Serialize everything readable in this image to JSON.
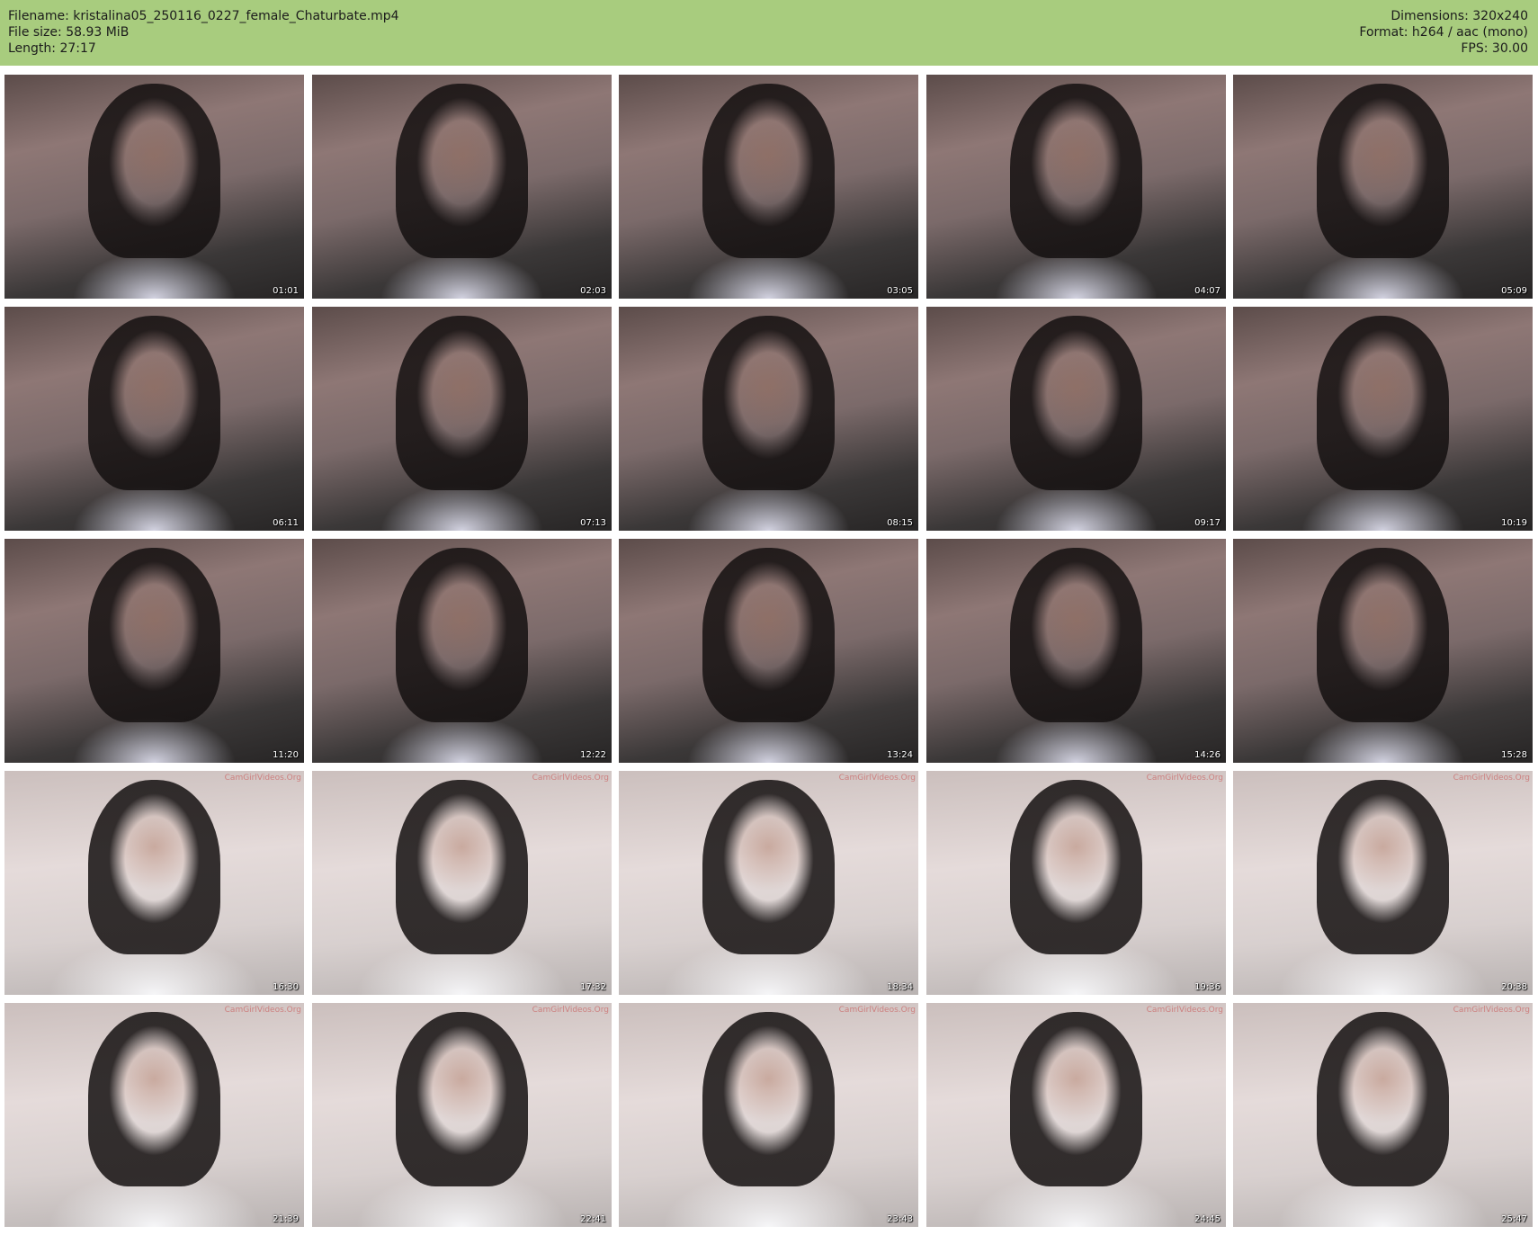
{
  "header": {
    "filename_line": "Filename: kristalina05_250116_0227_female_Chaturbate.mp4",
    "filesize_line": "File size: 58.93 MiB",
    "length_line": "Length: 27:17",
    "dimensions_line": "Dimensions: 320x240",
    "format_line": "Format: h264 / aac (mono)",
    "fps_line": "FPS: 30.00",
    "background_color": "#a8cc7e"
  },
  "watermark": "CamGirlVideos.Org",
  "thumbnails": [
    {
      "timestamp": "01:01",
      "tone": "dark"
    },
    {
      "timestamp": "02:03",
      "tone": "dark"
    },
    {
      "timestamp": "03:05",
      "tone": "dark"
    },
    {
      "timestamp": "04:07",
      "tone": "dark"
    },
    {
      "timestamp": "05:09",
      "tone": "dark"
    },
    {
      "timestamp": "06:11",
      "tone": "dark"
    },
    {
      "timestamp": "07:13",
      "tone": "dark"
    },
    {
      "timestamp": "08:15",
      "tone": "dark"
    },
    {
      "timestamp": "09:17",
      "tone": "dark"
    },
    {
      "timestamp": "10:19",
      "tone": "dark"
    },
    {
      "timestamp": "11:20",
      "tone": "dark"
    },
    {
      "timestamp": "12:22",
      "tone": "dark"
    },
    {
      "timestamp": "13:24",
      "tone": "dark"
    },
    {
      "timestamp": "14:26",
      "tone": "dark"
    },
    {
      "timestamp": "15:28",
      "tone": "dark"
    },
    {
      "timestamp": "16:30",
      "tone": "light"
    },
    {
      "timestamp": "17:32",
      "tone": "light"
    },
    {
      "timestamp": "18:34",
      "tone": "light"
    },
    {
      "timestamp": "19:36",
      "tone": "light"
    },
    {
      "timestamp": "20:38",
      "tone": "light"
    },
    {
      "timestamp": "21:39",
      "tone": "light"
    },
    {
      "timestamp": "22:41",
      "tone": "light"
    },
    {
      "timestamp": "23:43",
      "tone": "light"
    },
    {
      "timestamp": "24:45",
      "tone": "light"
    },
    {
      "timestamp": "25:47",
      "tone": "light"
    }
  ]
}
